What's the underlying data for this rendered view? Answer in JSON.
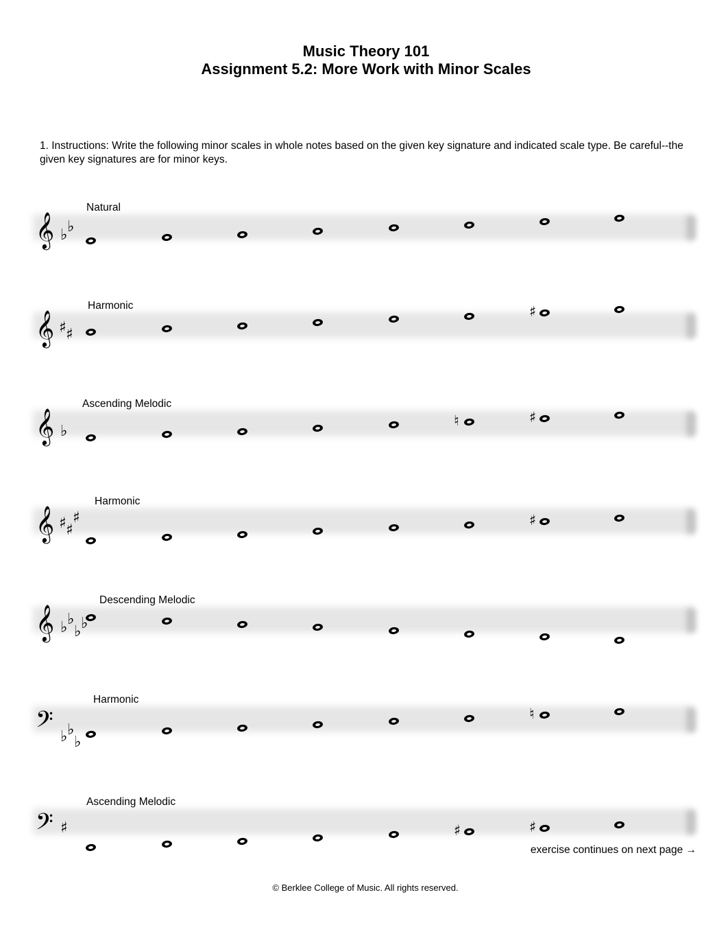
{
  "header": {
    "course_title": "Music Theory 101",
    "assignment_title": "Assignment 5.2: More Work with Minor Scales"
  },
  "instructions": "1. Instructions: Write the following minor scales in whole notes based on the given key signature and indicated scale type. Be careful--the given key signatures are for minor keys.",
  "exercises": [
    {
      "label": "Natural",
      "clef": "treble",
      "key_signature": {
        "type": "flat",
        "count": 2,
        "symbol": "♭"
      },
      "notes": [
        {
          "step": 0,
          "accidental": ""
        },
        {
          "step": 1,
          "accidental": ""
        },
        {
          "step": 2,
          "accidental": ""
        },
        {
          "step": 3,
          "accidental": ""
        },
        {
          "step": 4,
          "accidental": ""
        },
        {
          "step": 5,
          "accidental": ""
        },
        {
          "step": 6,
          "accidental": ""
        },
        {
          "step": 7,
          "accidental": ""
        }
      ]
    },
    {
      "label": "Harmonic",
      "clef": "treble",
      "key_signature": {
        "type": "sharp",
        "count": 2,
        "symbol": "♯"
      },
      "notes": [
        {
          "step": 0,
          "accidental": ""
        },
        {
          "step": 1,
          "accidental": ""
        },
        {
          "step": 2,
          "accidental": ""
        },
        {
          "step": 3,
          "accidental": ""
        },
        {
          "step": 4,
          "accidental": ""
        },
        {
          "step": 5,
          "accidental": ""
        },
        {
          "step": 6,
          "accidental": "♯"
        },
        {
          "step": 7,
          "accidental": ""
        }
      ]
    },
    {
      "label": "Ascending Melodic",
      "clef": "treble",
      "key_signature": {
        "type": "flat",
        "count": 1,
        "symbol": "♭"
      },
      "notes": [
        {
          "step": 0,
          "accidental": ""
        },
        {
          "step": 1,
          "accidental": ""
        },
        {
          "step": 2,
          "accidental": ""
        },
        {
          "step": 3,
          "accidental": ""
        },
        {
          "step": 4,
          "accidental": ""
        },
        {
          "step": 5,
          "accidental": "♮"
        },
        {
          "step": 6,
          "accidental": "♯"
        },
        {
          "step": 7,
          "accidental": ""
        }
      ]
    },
    {
      "label": "Harmonic",
      "clef": "treble",
      "key_signature": {
        "type": "sharp",
        "count": 3,
        "symbol": "♯"
      },
      "notes": [
        {
          "step": 0,
          "accidental": ""
        },
        {
          "step": 1,
          "accidental": ""
        },
        {
          "step": 2,
          "accidental": ""
        },
        {
          "step": 3,
          "accidental": ""
        },
        {
          "step": 4,
          "accidental": ""
        },
        {
          "step": 5,
          "accidental": ""
        },
        {
          "step": 6,
          "accidental": "♯"
        },
        {
          "step": 7,
          "accidental": ""
        }
      ]
    },
    {
      "label": "Descending Melodic",
      "clef": "treble",
      "key_signature": {
        "type": "flat",
        "count": 4,
        "symbol": "♭"
      },
      "notes": [
        {
          "step": 7,
          "accidental": ""
        },
        {
          "step": 6,
          "accidental": ""
        },
        {
          "step": 5,
          "accidental": ""
        },
        {
          "step": 4,
          "accidental": ""
        },
        {
          "step": 3,
          "accidental": ""
        },
        {
          "step": 2,
          "accidental": ""
        },
        {
          "step": 1,
          "accidental": ""
        },
        {
          "step": 0,
          "accidental": ""
        }
      ]
    },
    {
      "label": "Harmonic",
      "clef": "bass",
      "key_signature": {
        "type": "flat",
        "count": 3,
        "symbol": "♭"
      },
      "notes": [
        {
          "step": 0,
          "accidental": ""
        },
        {
          "step": 1,
          "accidental": ""
        },
        {
          "step": 2,
          "accidental": ""
        },
        {
          "step": 3,
          "accidental": ""
        },
        {
          "step": 4,
          "accidental": ""
        },
        {
          "step": 5,
          "accidental": ""
        },
        {
          "step": 6,
          "accidental": "♮"
        },
        {
          "step": 7,
          "accidental": ""
        }
      ]
    },
    {
      "label": "Ascending Melodic",
      "clef": "bass",
      "key_signature": {
        "type": "sharp",
        "count": 1,
        "symbol": "♯"
      },
      "notes": [
        {
          "step": 0,
          "accidental": ""
        },
        {
          "step": 1,
          "accidental": ""
        },
        {
          "step": 2,
          "accidental": ""
        },
        {
          "step": 3,
          "accidental": ""
        },
        {
          "step": 4,
          "accidental": ""
        },
        {
          "step": 5,
          "accidental": "♯"
        },
        {
          "step": 6,
          "accidental": "♯"
        },
        {
          "step": 7,
          "accidental": ""
        }
      ]
    }
  ],
  "clef_symbols": {
    "treble": "𝄞",
    "bass": "𝄢"
  },
  "continue_note": "exercise continues on next page →",
  "footer": "© Berklee College of Music. All rights reserved."
}
